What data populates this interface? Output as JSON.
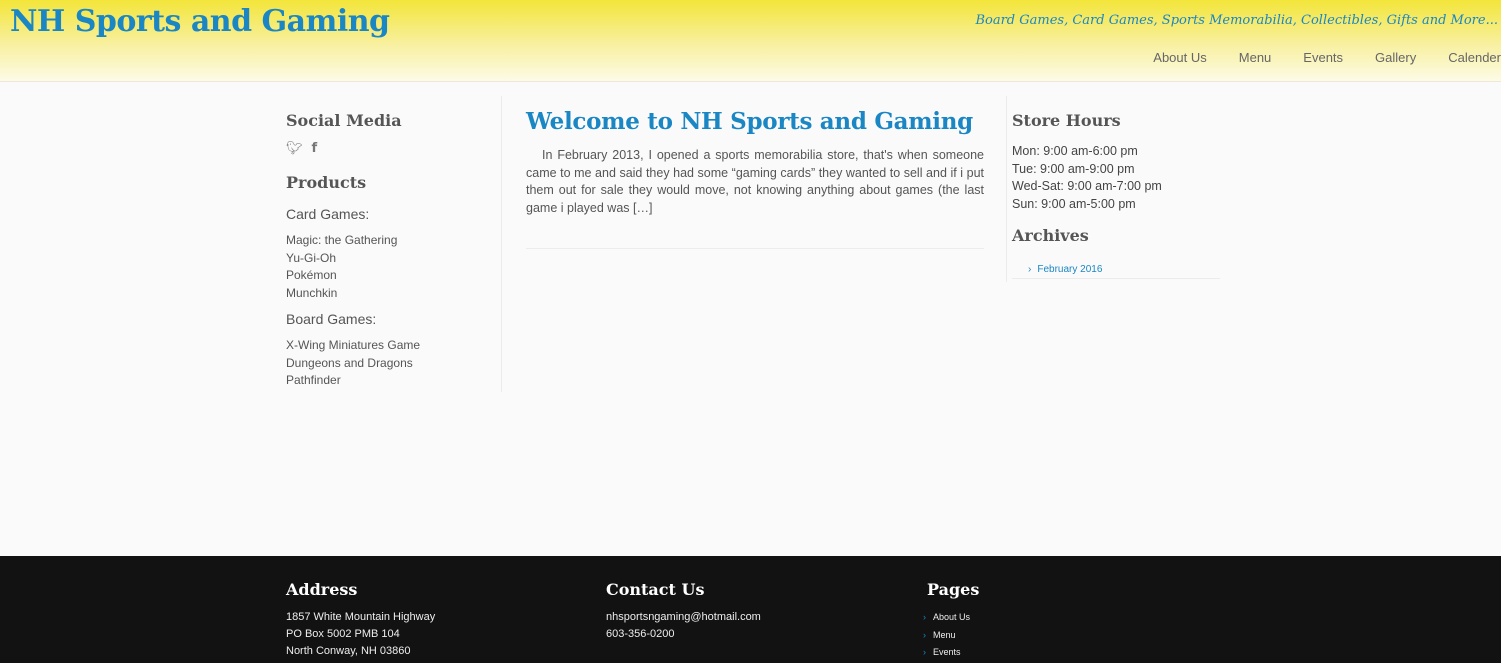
{
  "header": {
    "site_title": "NH Sports and Gaming",
    "tagline": "Board Games, Card Games, Sports Memorabilia, Collectibles, Gifts and More...",
    "nav": [
      "About Us",
      "Menu",
      "Events",
      "Gallery",
      "Calender"
    ]
  },
  "sidebar_left": {
    "social_title": "Social Media",
    "social_icons": [
      "twitter-icon",
      "facebook-icon"
    ],
    "products_title": "Products",
    "card_games_title": "Card Games:",
    "card_games": [
      "Magic: the Gathering",
      "Yu-Gi-Oh",
      "Pokémon",
      "Munchkin"
    ],
    "board_games_title": "Board Games:",
    "board_games": [
      "X-Wing Miniatures Game",
      "Dungeons and Dragons",
      "Pathfinder"
    ]
  },
  "post": {
    "title": "Welcome to NH Sports and Gaming",
    "excerpt": "In February 2013, I opened a sports memorabilia store, that's when someone came to me and said they had some “gaming cards” they wanted to sell and if i put them out for sale they would move, not knowing anything about games (the last game i played was […]"
  },
  "sidebar_right": {
    "hours_title": "Store Hours",
    "hours": [
      "Mon: 9:00 am-6:00 pm",
      "Tue: 9:00 am-9:00 pm",
      "Wed-Sat: 9:00 am-7:00 pm",
      "Sun: 9:00 am-5:00 pm"
    ],
    "archives_title": "Archives",
    "archives": [
      "February 2016"
    ]
  },
  "footer": {
    "address_title": "Address",
    "address_lines": [
      "1857 White Mountain Highway",
      "PO Box 5002 PMB 104",
      "North Conway, NH 03860"
    ],
    "contact_title": "Contact Us",
    "contact_lines": [
      "nhsportsngaming@hotmail.com",
      "603-356-0200"
    ],
    "pages_title": "Pages",
    "pages": [
      "About Us",
      "Menu",
      "Events"
    ]
  },
  "colors": {
    "accent": "#1a86c4",
    "header_top": "#f3e53a",
    "header_bottom": "#fdfbe6",
    "footer_bg": "#121212"
  }
}
